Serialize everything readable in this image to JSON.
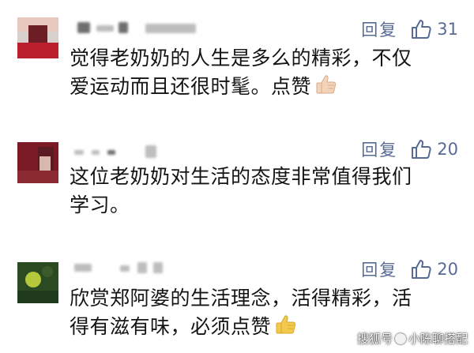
{
  "comments": [
    {
      "reply_label": "回复",
      "like_count": "31",
      "line1": "觉得老奶奶的人生是多么的精彩，不仅",
      "line2": "爱运动而且还很时髦。点赞",
      "icon": "thumbs-up-emoji",
      "avatar_colors": [
        "#b9202c",
        "#e8c9c0",
        "#6b1f25"
      ]
    },
    {
      "reply_label": "回复",
      "like_count": "20",
      "line1": "这位老奶奶对生活的态度非常值得我们",
      "line2": "学习。",
      "avatar_colors": [
        "#7a1a24",
        "#d8b8ac",
        "#5a1c22"
      ]
    },
    {
      "reply_label": "回复",
      "like_count": "20",
      "line1": "欣赏郑阿婆的生活理念，活得精彩，活",
      "line2": "得有滋有味，必须点赞",
      "icon": "thumbs-up-emoji",
      "avatar_colors": [
        "#1f3a1c",
        "#b6c93a",
        "#3c5a2a"
      ]
    }
  ],
  "watermark": {
    "left": "搜狐号",
    "right": "小陈聊搭配"
  },
  "colors": {
    "action": "#576b95",
    "text": "#141414",
    "emoji": "#f2c94c"
  }
}
